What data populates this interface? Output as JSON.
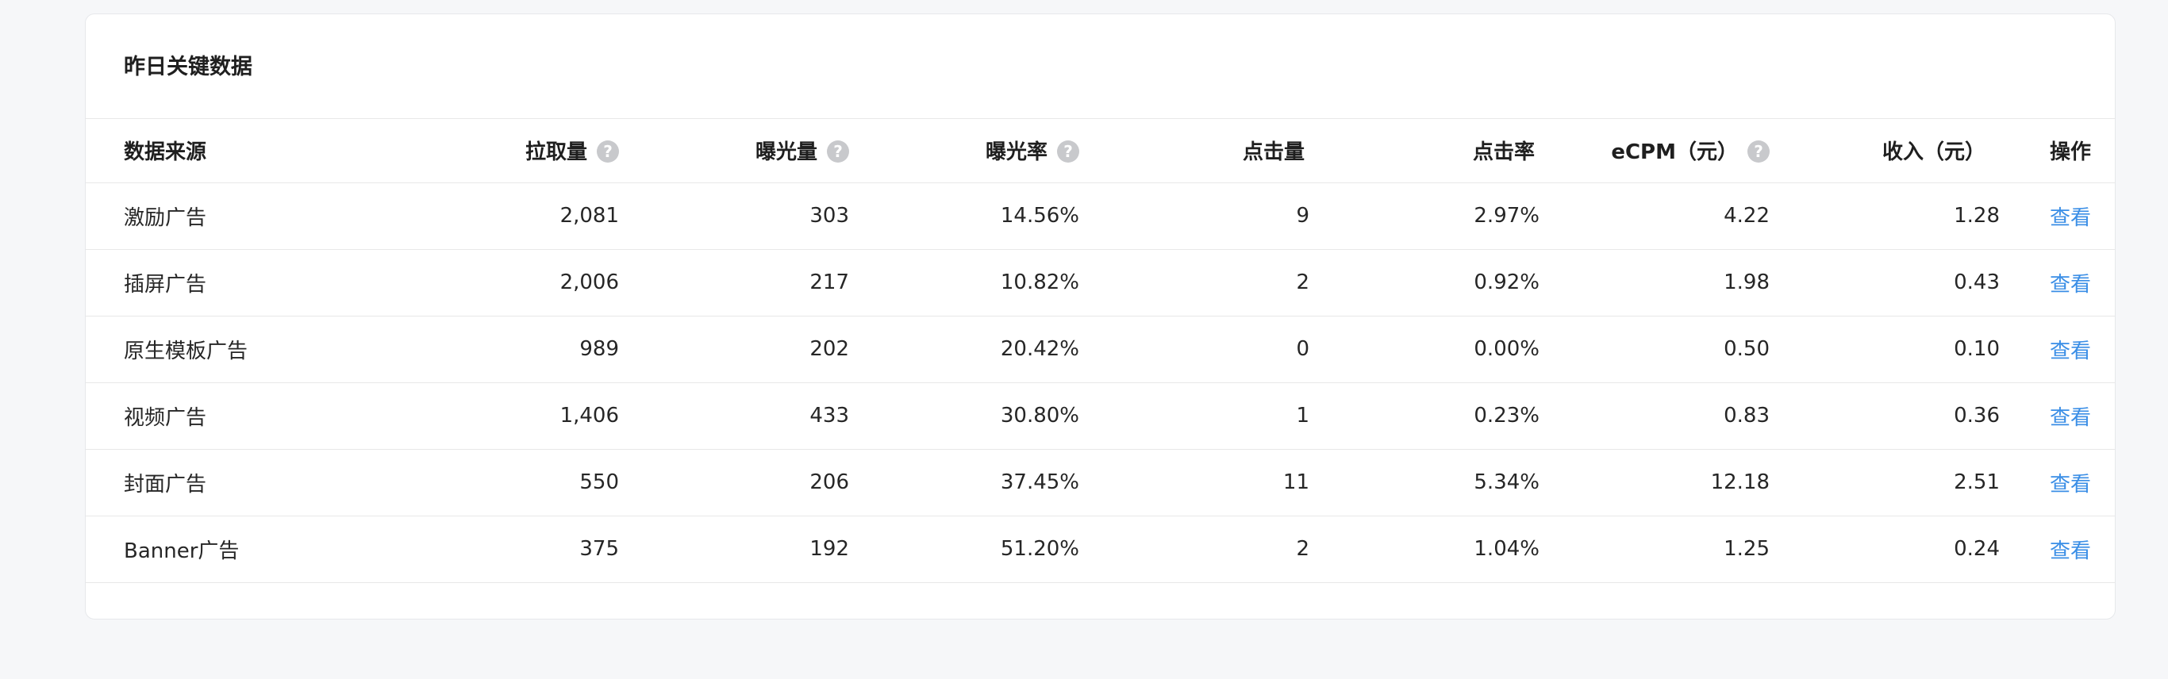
{
  "card": {
    "title": "昨日关键数据"
  },
  "table": {
    "columns": [
      {
        "label": "数据来源",
        "help": false
      },
      {
        "label": "拉取量",
        "help": true
      },
      {
        "label": "曝光量",
        "help": true
      },
      {
        "label": "曝光率",
        "help": true
      },
      {
        "label": "点击量",
        "help": false
      },
      {
        "label": "点击率",
        "help": false
      },
      {
        "label": "eCPM（元）",
        "help": true
      },
      {
        "label": "收入（元）",
        "help": false
      },
      {
        "label": "操作",
        "help": false
      }
    ],
    "help_glyph": "?",
    "rows": [
      {
        "source": "激励广告",
        "pulls": "2,081",
        "impressions": "303",
        "impression_rate": "14.56%",
        "clicks": "9",
        "ctr": "2.97%",
        "ecpm": "4.22",
        "revenue": "1.28",
        "action": "查看"
      },
      {
        "source": "插屏广告",
        "pulls": "2,006",
        "impressions": "217",
        "impression_rate": "10.82%",
        "clicks": "2",
        "ctr": "0.92%",
        "ecpm": "1.98",
        "revenue": "0.43",
        "action": "查看"
      },
      {
        "source": "原生模板广告",
        "pulls": "989",
        "impressions": "202",
        "impression_rate": "20.42%",
        "clicks": "0",
        "ctr": "0.00%",
        "ecpm": "0.50",
        "revenue": "0.10",
        "action": "查看"
      },
      {
        "source": "视频广告",
        "pulls": "1,406",
        "impressions": "433",
        "impression_rate": "30.80%",
        "clicks": "1",
        "ctr": "0.23%",
        "ecpm": "0.83",
        "revenue": "0.36",
        "action": "查看"
      },
      {
        "source": "封面广告",
        "pulls": "550",
        "impressions": "206",
        "impression_rate": "37.45%",
        "clicks": "11",
        "ctr": "5.34%",
        "ecpm": "12.18",
        "revenue": "2.51",
        "action": "查看"
      },
      {
        "source": "Banner广告",
        "pulls": "375",
        "impressions": "192",
        "impression_rate": "51.20%",
        "clicks": "2",
        "ctr": "1.04%",
        "ecpm": "1.25",
        "revenue": "0.24",
        "action": "查看"
      }
    ]
  },
  "colors": {
    "link": "#3a8ee6",
    "help_icon": "#c8c9cc",
    "background": "#f6f7f9"
  }
}
